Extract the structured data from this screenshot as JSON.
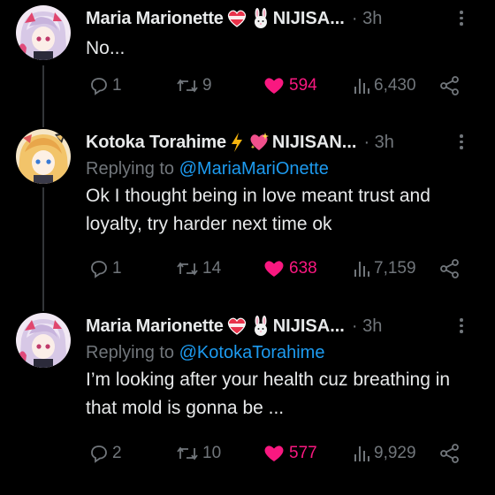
{
  "tweets": [
    {
      "name": "Maria Marionette",
      "suffix": "NIJISA...",
      "time": "· 3h",
      "replying_label": "",
      "replying_handle": "",
      "text": "No...",
      "replies": "1",
      "retweets": "9",
      "likes": "594",
      "views": "6,430",
      "avatar": "maria",
      "emojis": [
        "heart-ribbon-icon",
        "rabbit-icon"
      ]
    },
    {
      "name": "Kotoka Torahime",
      "suffix": "NIJISAN...",
      "time": "· 3h",
      "replying_label": "Replying to",
      "replying_handle": "@MariaMariOnette",
      "text": "Ok I thought being in love meant trust and loyalty, try harder next time ok",
      "replies": "1",
      "retweets": "14",
      "likes": "638",
      "views": "7,159",
      "avatar": "kotoka",
      "emojis": [
        "lightning-icon",
        "sparkling-heart-icon"
      ]
    },
    {
      "name": "Maria Marionette",
      "suffix": "NIJISA...",
      "time": "· 3h",
      "replying_label": "Replying to",
      "replying_handle": "@KotokaTorahime",
      "text": "I’m looking after your health cuz breathing in that mold is gonna be ...",
      "replies": "2",
      "retweets": "10",
      "likes": "577",
      "views": "9,929",
      "avatar": "maria",
      "emojis": [
        "heart-ribbon-icon",
        "rabbit-icon"
      ]
    }
  ],
  "colors": {
    "background": "#000000",
    "text": "#e7e9ea",
    "muted": "#71767b",
    "link": "#1d9bf0",
    "like": "#f91880",
    "thread_line": "#333639"
  }
}
